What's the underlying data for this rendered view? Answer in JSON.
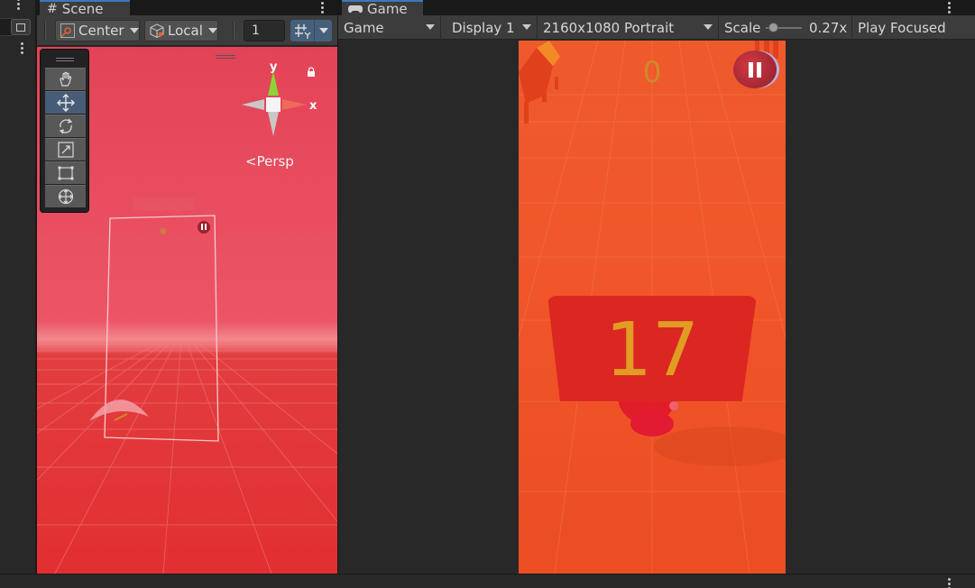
{
  "colors": {
    "accent": "#3a79bb",
    "scene_sky": "#e34357",
    "scene_ground": "#e22f31",
    "game_ground": "#ee5a2c",
    "counter_board": "#dc2621",
    "counter_digits": "#e09c23"
  },
  "scene": {
    "tab_label": "Scene",
    "tab_icon": "hash-icon",
    "pivot_mode": "Center",
    "pivot_rotation": "Local",
    "grid_size": "1",
    "projection_label": "Persp",
    "gizmo_axes": {
      "y": "y",
      "x": "x"
    },
    "tools": [
      "hand-tool",
      "move-tool",
      "rotate-tool",
      "scale-tool",
      "rect-tool",
      "transform-tool"
    ],
    "active_tool": "move-tool"
  },
  "game": {
    "tab_label": "Game",
    "tab_icon": "gamepad-icon",
    "mode": "Game",
    "display": "Display 1",
    "resolution": "2160x1080 Portrait",
    "scale_label": "Scale",
    "scale_value": "0.27x",
    "scale_fraction": 0.1,
    "play_mode": "Play Focused",
    "score": "0",
    "counter": "17"
  }
}
